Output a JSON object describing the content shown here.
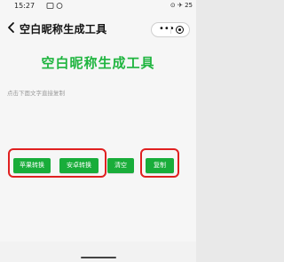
{
  "status_bar": {
    "time": "15:27",
    "indicators": [
      "notification-icon",
      "wechat-icon"
    ],
    "system": "⊙ ✈ 25"
  },
  "header": {
    "title": "空白昵称生成工具",
    "capsule": {
      "more_label": "•••"
    }
  },
  "main": {
    "heading": "空白昵称生成工具",
    "hint": "点击下面文字直接复制",
    "buttons": {
      "apple": "苹果转换",
      "android": "安卓转换",
      "clear": "清空",
      "copy": "复制"
    }
  },
  "colors": {
    "accent": "#1fb53f",
    "button": "#19ad3a",
    "highlight": "#e02020"
  }
}
